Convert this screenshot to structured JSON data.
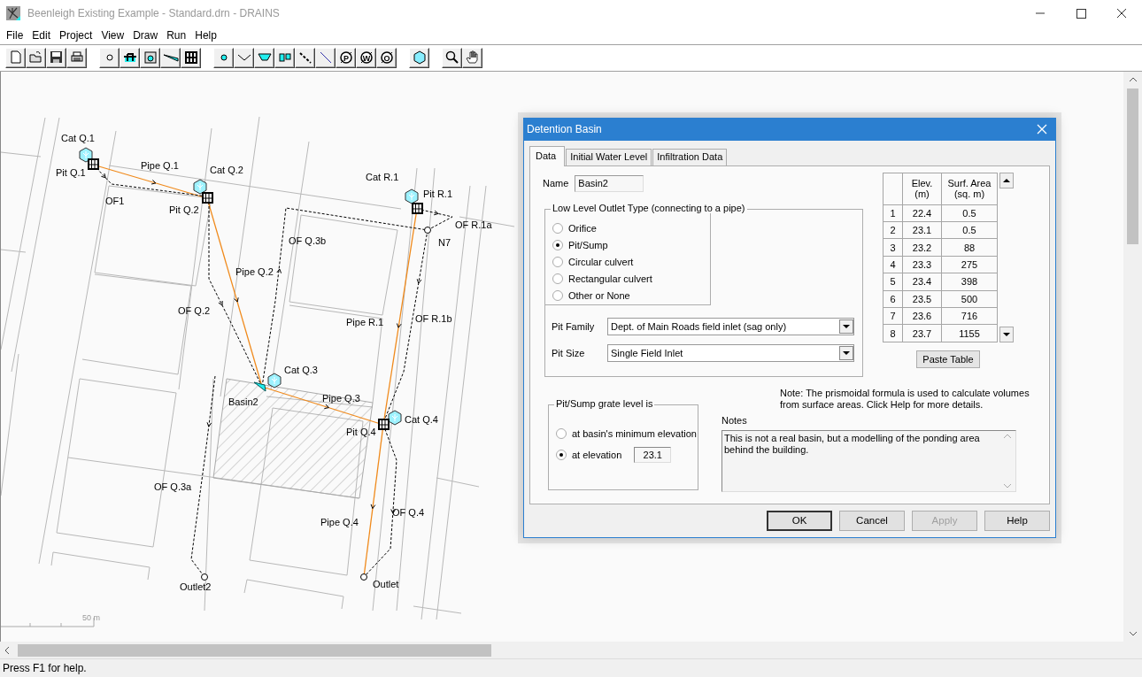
{
  "window": {
    "title": "Beenleigh Existing Example - Standard.drn - DRAINS"
  },
  "menu": [
    "File",
    "Edit",
    "Project",
    "View",
    "Draw",
    "Run",
    "Help"
  ],
  "toolbar": {
    "symbol_letters": [
      "P",
      "W",
      "O"
    ]
  },
  "map": {
    "labels": [
      {
        "text": "Cat Q.1"
      },
      {
        "text": "Pit Q.1"
      },
      {
        "text": "Pipe Q.1"
      },
      {
        "text": "Cat Q.2"
      },
      {
        "text": "Pit Q.2"
      },
      {
        "text": "OF1"
      },
      {
        "text": "Cat R.1"
      },
      {
        "text": "Pit R.1"
      },
      {
        "text": "OF R.1a"
      },
      {
        "text": "N7"
      },
      {
        "text": "OF Q.3b"
      },
      {
        "text": "Pipe Q.2"
      },
      {
        "text": "OF Q.2"
      },
      {
        "text": "Pipe R.1"
      },
      {
        "text": "OF R.1b"
      },
      {
        "text": "Cat Q.3"
      },
      {
        "text": "Basin2"
      },
      {
        "text": "Pipe Q.3"
      },
      {
        "text": "Pit Q.4"
      },
      {
        "text": "Cat Q.4"
      },
      {
        "text": "OF Q.3a"
      },
      {
        "text": "Pipe Q.4"
      },
      {
        "text": "OF Q.4"
      },
      {
        "text": "Outlet2"
      },
      {
        "text": "Outlet"
      }
    ],
    "scale_label": "50 m"
  },
  "dialog": {
    "title": "Detention Basin",
    "tabs": [
      {
        "label": "Data",
        "selected": true
      },
      {
        "label": "Initial Water Level",
        "selected": false
      },
      {
        "label": "Infiltration Data",
        "selected": false
      }
    ],
    "name_label": "Name",
    "name_value": "Basin2",
    "outlet_group": {
      "title": "Low Level Outlet Type (connecting to a pipe)",
      "options": [
        {
          "label": "Orifice",
          "selected": false
        },
        {
          "label": "Pit/Sump",
          "selected": true
        },
        {
          "label": "Circular culvert",
          "selected": false
        },
        {
          "label": "Rectangular culvert",
          "selected": false
        },
        {
          "label": "Other or None",
          "selected": false
        }
      ]
    },
    "pit_family": {
      "label": "Pit Family",
      "value": "Dept. of Main Roads field inlet (sag only)"
    },
    "pit_size": {
      "label": "Pit Size",
      "value": "Single Field Inlet"
    },
    "table": {
      "columns": [
        "",
        "Elev. (m)",
        "Surf. Area (sq. m)"
      ],
      "rows": [
        [
          "1",
          "22.4",
          "0.5"
        ],
        [
          "2",
          "23.1",
          "0.5"
        ],
        [
          "3",
          "23.2",
          "88"
        ],
        [
          "4",
          "23.3",
          "275"
        ],
        [
          "5",
          "23.4",
          "398"
        ],
        [
          "6",
          "23.5",
          "500"
        ],
        [
          "7",
          "23.6",
          "716"
        ],
        [
          "8",
          "23.7",
          "1155"
        ]
      ]
    },
    "paste_button": "Paste Table",
    "note": "Note: The prismoidal formula is used to calculate volumes from surface areas.  Click Help for more details.",
    "grate_group": {
      "title": "Pit/Sump grate level is",
      "options": [
        {
          "label": "at basin's minimum elevation",
          "selected": false
        },
        {
          "label": "at elevation",
          "selected": true
        }
      ],
      "elevation_value": "23.1"
    },
    "notes": {
      "label": "Notes",
      "value": "This is not a real basin, but a modelling of the ponding area behind the building."
    },
    "buttons": [
      {
        "label": "OK",
        "disabled": false
      },
      {
        "label": "Cancel",
        "disabled": false
      },
      {
        "label": "Apply",
        "disabled": true
      },
      {
        "label": "Help",
        "disabled": false
      }
    ]
  },
  "status_bar": "Press F1 for help."
}
